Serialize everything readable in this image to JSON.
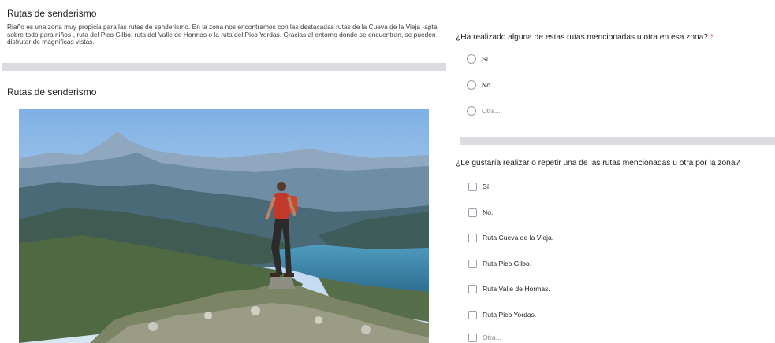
{
  "section": {
    "title": "Rutas de senderismo",
    "description": "Riaño es una zona muy propicia para las rutas de senderismo. En la zona nos encontramos con las destacadas rutas de la Cueva de la Vieja -apta sobre todo para niños-, ruta del Pico Gilbo, ruta del Valle de Hormas o la ruta del Pico Yordas. Gracias al entorno donde se encuentran, se pueden disfrutar de magníficas vistas."
  },
  "image_block": {
    "title": "Rutas de senderismo"
  },
  "question1": {
    "title": "¿Ha realizado alguna de estas rutas mencionadas u otra en esa zona?",
    "required_marker": "*",
    "options": [
      "Sí.",
      "No.",
      "Otra..."
    ]
  },
  "question2": {
    "title": "¿Le gustaría realizar  o repetir una de las rutas mencionadas u otra por la zona?",
    "options": [
      "Sí.",
      "No.",
      "Ruta Cueva de la Vieja.",
      "Ruta Pico Gilbo.",
      "Ruta Valle de Hormas.",
      "Ruta Pico Yordas.",
      "Otra..."
    ]
  },
  "colors": {
    "divider": "#dadce0",
    "required": "#d93025",
    "control_border": "#9aa0a6"
  }
}
